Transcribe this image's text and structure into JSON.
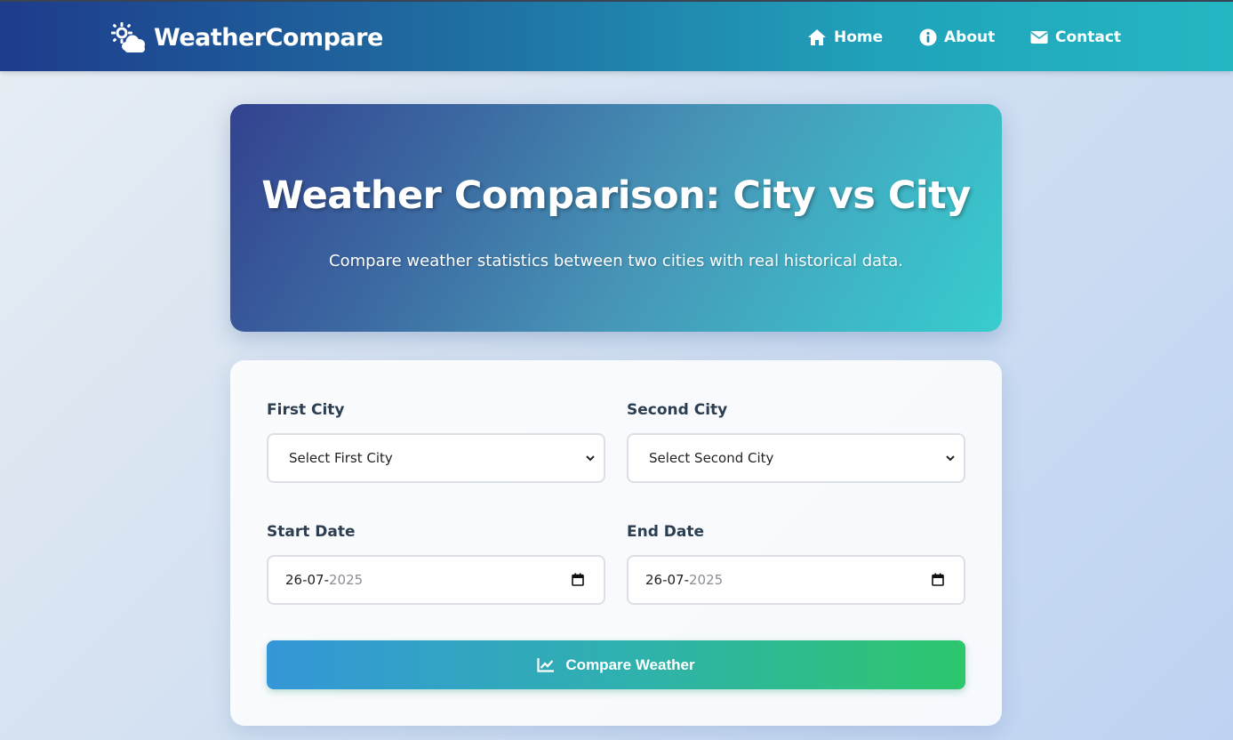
{
  "navbar": {
    "brand": "WeatherCompare",
    "brand_icon": "sun-cloud-icon",
    "items": [
      {
        "label": "Home",
        "icon": "home-icon"
      },
      {
        "label": "About",
        "icon": "info-icon"
      },
      {
        "label": "Contact",
        "icon": "envelope-icon"
      }
    ]
  },
  "hero": {
    "title": "Weather Comparison: City vs City",
    "subtitle": "Compare weather statistics between two cities with real historical data."
  },
  "form": {
    "first_city": {
      "label": "First City",
      "value": "Select First City"
    },
    "second_city": {
      "label": "Second City",
      "value": "Select Second City"
    },
    "start_date": {
      "label": "Start Date",
      "day_month": "26-07-",
      "year": "2025"
    },
    "end_date": {
      "label": "End Date",
      "day_month": "26-07-",
      "year": "2025"
    },
    "submit": {
      "label": "Compare Weather",
      "icon": "chart-line-icon"
    }
  },
  "colors": {
    "navbar_start": "#1e3c8c",
    "navbar_end": "#24b7c2",
    "hero_start": "#33428f",
    "hero_end": "#37cdcd",
    "button_start": "#3596d8",
    "button_end": "#2dc76c"
  }
}
